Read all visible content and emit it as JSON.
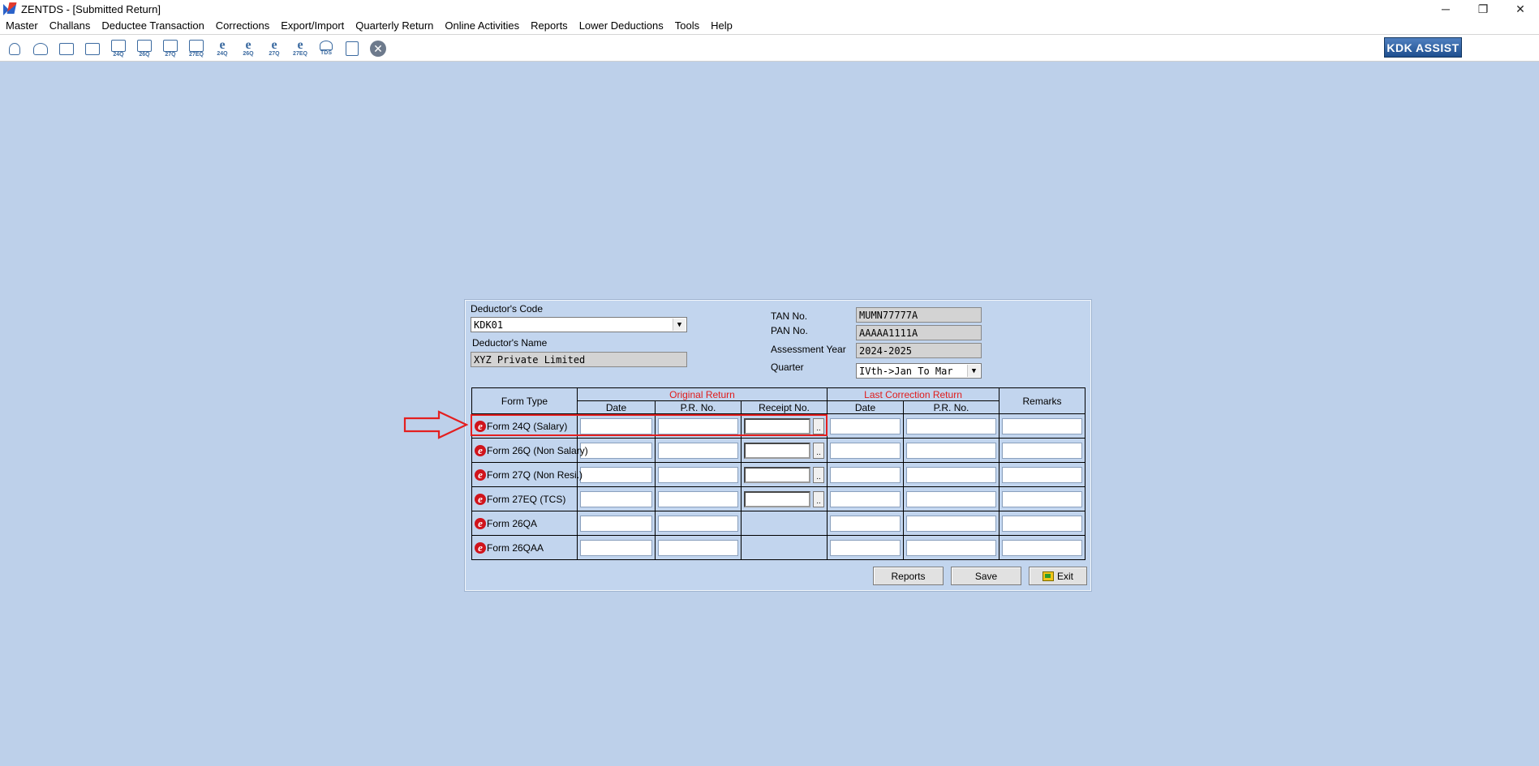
{
  "window": {
    "title": "ZENTDS - [Submitted Return]",
    "controls": [
      "─",
      "❐",
      "✕"
    ]
  },
  "menu": [
    "Master",
    "Challans",
    "Deductee Transaction",
    "Corrections",
    "Export/Import",
    "Quarterly Return",
    "Online Activities",
    "Reports",
    "Lower Deductions",
    "Tools",
    "Help"
  ],
  "toolbar": {
    "icons": [
      {
        "name": "deductor-icon",
        "sub": ""
      },
      {
        "name": "deductees-icon",
        "sub": ""
      },
      {
        "name": "employee-icon",
        "sub": ""
      },
      {
        "name": "employee-2-icon",
        "sub": ""
      },
      {
        "name": "form-24q-icon",
        "sub": "24Q"
      },
      {
        "name": "form-26q-icon",
        "sub": "26Q"
      },
      {
        "name": "form-27q-icon",
        "sub": "27Q"
      },
      {
        "name": "form-27eq-icon",
        "sub": "27EQ"
      },
      {
        "name": "e-24q-icon",
        "sub": "24Q"
      },
      {
        "name": "e-26q-icon",
        "sub": "26Q"
      },
      {
        "name": "e-27q-icon",
        "sub": "27Q"
      },
      {
        "name": "e-27eq-icon",
        "sub": "27EQ"
      },
      {
        "name": "tds-icon",
        "sub": "TDS"
      },
      {
        "name": "document-icon",
        "sub": ""
      },
      {
        "name": "close-icon",
        "sub": ""
      }
    ],
    "assist_label": "KDK ASSIST"
  },
  "form": {
    "deductor_code_label": "Deductor's Code",
    "deductor_code_value": "KDK01",
    "deductor_name_label": "Deductor's Name",
    "deductor_name_value": "XYZ Private Limited",
    "tan_label": "TAN No.",
    "tan_value": "MUMN77777A",
    "pan_label": "PAN No.",
    "pan_value": "AAAAA1111A",
    "ay_label": "Assessment Year",
    "ay_value": "2024-2025",
    "quarter_label": "Quarter",
    "quarter_value": "IVth->Jan To Mar"
  },
  "grid": {
    "col_form_type": "Form Type",
    "group_original": "Original Return",
    "group_correction": "Last Correction Return",
    "col_remarks": "Remarks",
    "col_date": "Date",
    "col_pr": "P.R. No.",
    "col_receipt": "Receipt No.",
    "col_date2": "Date",
    "col_pr2": "P.R. No.",
    "rows": [
      {
        "label": "Form 24Q (Salary)",
        "receipt": true
      },
      {
        "label": "Form 26Q (Non Salary)",
        "receipt": true
      },
      {
        "label": "Form 27Q (Non Resi.)",
        "receipt": true
      },
      {
        "label": "Form 27EQ (TCS)",
        "receipt": true
      },
      {
        "label": "Form 26QA",
        "receipt": false
      },
      {
        "label": "Form 26QAA",
        "receipt": false
      }
    ]
  },
  "buttons": {
    "reports": "Reports",
    "save": "Save",
    "exit": "Exit"
  },
  "colors": {
    "background": "#bdd0ea",
    "group_header": "#e01c1c",
    "annotation": "#e41f1f"
  }
}
